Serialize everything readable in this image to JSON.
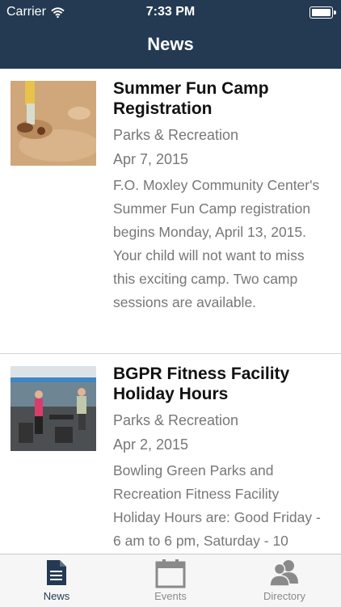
{
  "status_bar": {
    "carrier": "Carrier",
    "time": "7:33 PM"
  },
  "nav": {
    "title": "News"
  },
  "news": [
    {
      "title": "Summer Fun Camp Registration",
      "source": "Parks & Recreation",
      "date": "Apr 7, 2015",
      "summary": "F.O. Moxley Community Center's Summer Fun Camp registration begins Monday, April 13, 2015. Your child will not want to miss this exciting camp. Two camp sessions are available."
    },
    {
      "title": "BGPR Fitness Facility Holiday Hours",
      "source": "Parks & Recreation",
      "date": "Apr 2, 2015",
      "summary": "Bowling Green Parks and Recreation Fitness Facility Holiday Hours are: Good Friday - 6 am to 6 pm, Saturday - 10"
    }
  ],
  "tabs": [
    {
      "label": "News",
      "icon": "document-icon",
      "active": true
    },
    {
      "label": "Events",
      "icon": "calendar-icon",
      "active": false
    },
    {
      "label": "Directory",
      "icon": "people-icon",
      "active": false
    }
  ],
  "colors": {
    "nav_bar": "#243a52",
    "active_tab": "#243a52",
    "inactive_tab": "#8a8a8a"
  }
}
